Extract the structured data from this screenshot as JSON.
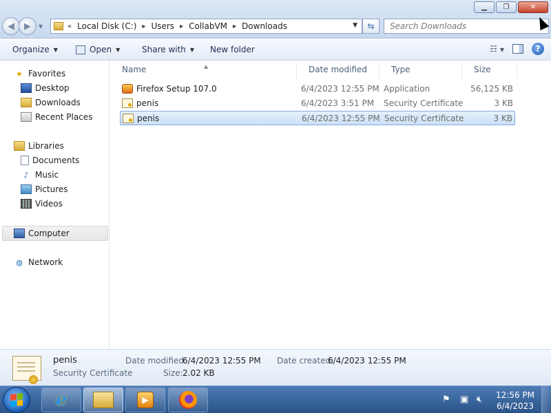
{
  "window": {
    "minimize_icon": "minimize-icon",
    "maximize_icon": "restore-icon",
    "close_icon": "close-icon"
  },
  "nav": {
    "back_icon": "back-arrow-icon",
    "forward_icon": "forward-arrow-icon"
  },
  "address": {
    "overflow": "«",
    "crumbs": [
      "Local Disk (C:)",
      "Users",
      "CollabVM",
      "Downloads"
    ]
  },
  "search": {
    "placeholder": "Search Downloads"
  },
  "toolbar": {
    "organize": "Organize",
    "open": "Open",
    "share_with": "Share with",
    "new_folder": "New folder"
  },
  "sidebar": {
    "favorites": "Favorites",
    "desktop": "Desktop",
    "downloads": "Downloads",
    "recent_places": "Recent Places",
    "libraries": "Libraries",
    "documents": "Documents",
    "music": "Music",
    "pictures": "Pictures",
    "videos": "Videos",
    "computer": "Computer",
    "network": "Network"
  },
  "columns": {
    "name": "Name",
    "date_modified": "Date modified",
    "type": "Type",
    "size": "Size"
  },
  "files": [
    {
      "name": "Firefox Setup 107.0",
      "date": "6/4/2023 12:55 PM",
      "type": "Application",
      "size": "56,125 KB",
      "icon": "firefox-setup-icon"
    },
    {
      "name": "penis",
      "date": "6/4/2023 3:51 PM",
      "type": "Security Certificate",
      "size": "3 KB",
      "icon": "certificate-icon"
    },
    {
      "name": "penis",
      "date": "6/4/2023 12:55 PM",
      "type": "Security Certificate",
      "size": "3 KB",
      "icon": "certificate-icon"
    }
  ],
  "details": {
    "name": "penis",
    "type": "Security Certificate",
    "date_modified_label": "Date modified:",
    "date_modified": "6/4/2023 12:55 PM",
    "date_created_label": "Date created:",
    "date_created": "6/4/2023 12:55 PM",
    "size_label": "Size:",
    "size": "2.02 KB"
  },
  "taskbar": {
    "time": "12:56 PM",
    "date": "6/4/2023",
    "apps": [
      "internet-explorer-icon",
      "windows-explorer-icon",
      "media-player-icon",
      "firefox-icon"
    ]
  }
}
